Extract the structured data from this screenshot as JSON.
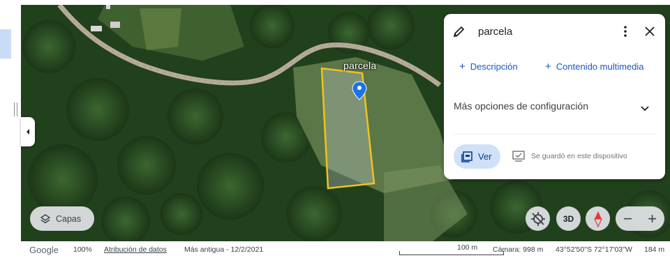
{
  "map": {
    "parcel_label": "parcela"
  },
  "info_card": {
    "title": "parcela",
    "add_description": "Descripción",
    "add_media": "Contenido multimedia",
    "more_options": "Más opciones de configuración",
    "view_button": "Ver",
    "saved_status": "Se guardó en este dispositivo"
  },
  "controls": {
    "layers_label": "Capas",
    "three_d_label": "3D",
    "zoom_out_label": "−",
    "zoom_in_label": "+"
  },
  "status_bar": {
    "logo": "Google",
    "zoom": "100%",
    "attribution": "Atribución de datos",
    "imagery_date": "Más antigua - 12/2/2021",
    "scale": "100 m",
    "camera": "Cámara: 998 m",
    "coordinates": "43°52'50\"S 72°17'03\"W",
    "elevation": "184 m"
  },
  "icons": {
    "edit": "pencil-icon",
    "menu": "more-vert-icon",
    "close": "close-icon",
    "add": "plus-icon",
    "expand": "chevron-down-icon",
    "view": "view-icon",
    "saved": "device-saved-icon",
    "layers": "layers-icon",
    "location": "location-off-icon",
    "compass": "compass-icon",
    "collapse": "chevron-left-icon",
    "marker": "map-pin-icon"
  },
  "colors": {
    "accent_blue": "#1a56c4",
    "button_fill": "#cfe0f8",
    "parcel_outline": "#f2c21a",
    "pin": "#1a73e8",
    "compass_red": "#e53935"
  }
}
